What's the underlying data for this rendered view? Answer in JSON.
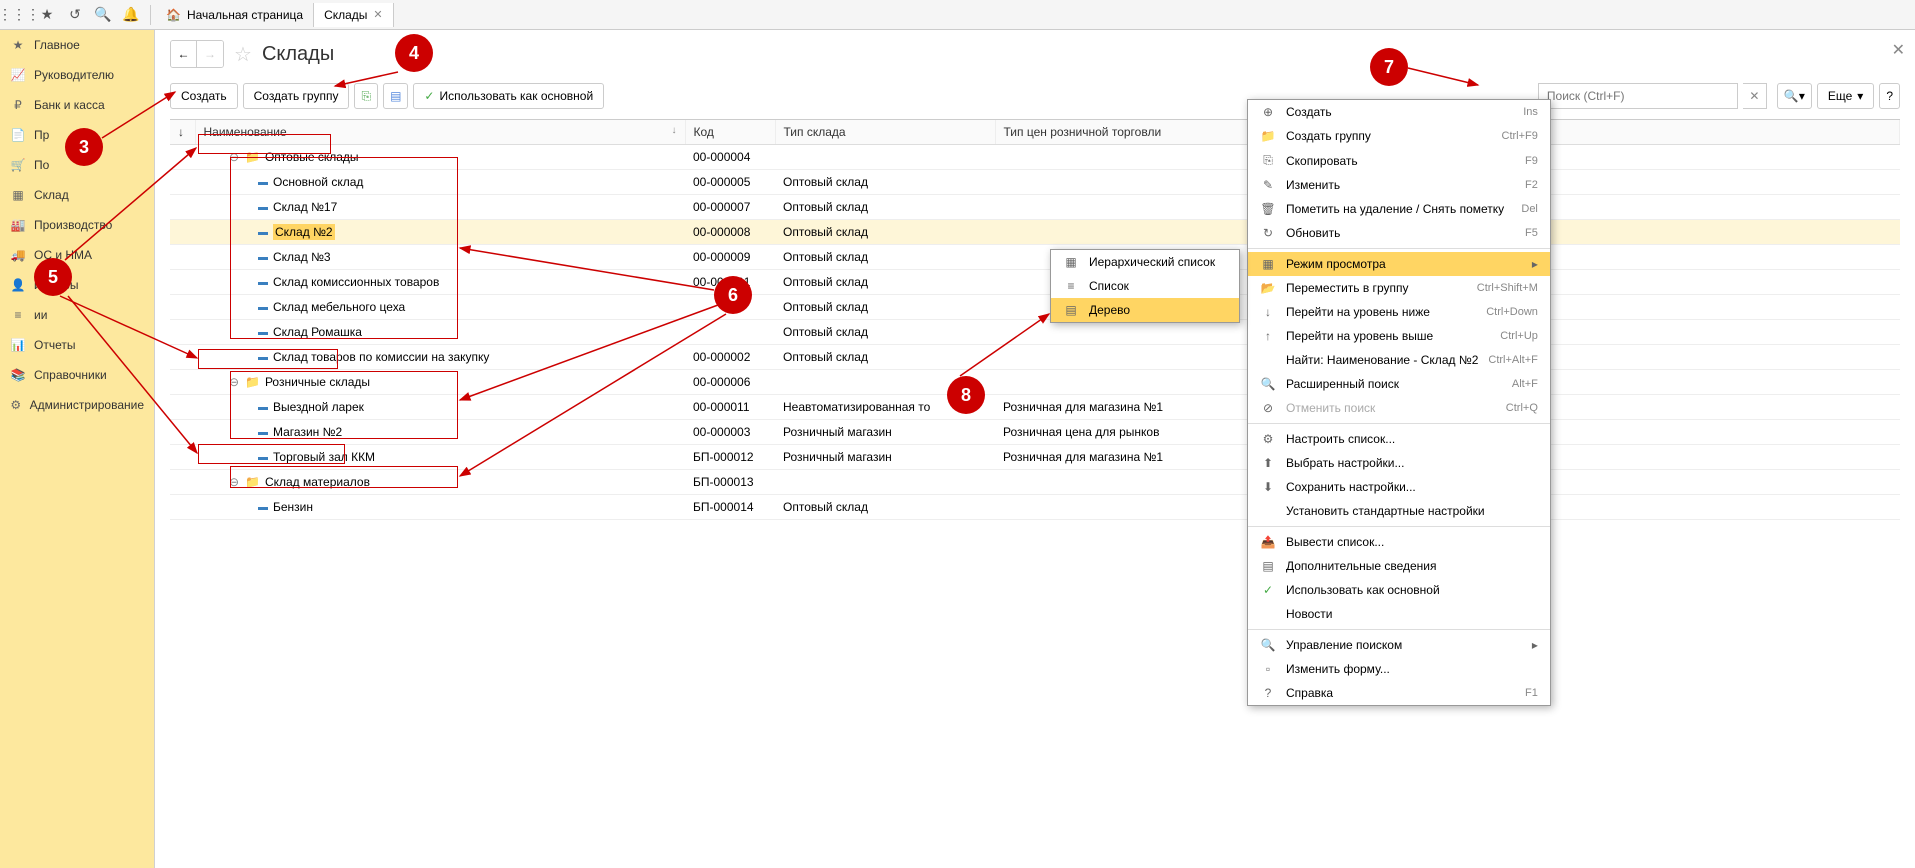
{
  "topbar": {
    "home_tab": "Начальная страница",
    "tab2": "Склады"
  },
  "sidebar": {
    "items": [
      {
        "icon": "★",
        "label": "Главное"
      },
      {
        "icon": "📈",
        "label": "Руководителю"
      },
      {
        "icon": "₽",
        "label": "Банк и касса"
      },
      {
        "icon": "📄",
        "label": "Пр"
      },
      {
        "icon": "🛒",
        "label": "По"
      },
      {
        "icon": "▦",
        "label": "Склад"
      },
      {
        "icon": "🏭",
        "label": "Производство"
      },
      {
        "icon": "🚚",
        "label": "ОС и НМА"
      },
      {
        "icon": "👤",
        "label": "и кадры"
      },
      {
        "icon": "≡",
        "label": "ии"
      },
      {
        "icon": "📊",
        "label": "Отчеты"
      },
      {
        "icon": "📚",
        "label": "Справочники"
      },
      {
        "icon": "⚙",
        "label": "Администрирование"
      }
    ]
  },
  "page": {
    "title": "Склады"
  },
  "toolbar": {
    "create": "Создать",
    "create_group": "Создать группу",
    "use_as_main": "Использовать как основной",
    "search_placeholder": "Поиск (Ctrl+F)",
    "more": "Еще"
  },
  "columns": {
    "name": "Наименование",
    "code": "Код",
    "type": "Тип склада",
    "price_type": "Тип цен розничной торговли"
  },
  "rows": [
    {
      "lvl": 1,
      "folder": true,
      "exp": "⊖",
      "name": "Оптовые склады",
      "code": "00-000004",
      "type": "",
      "price": ""
    },
    {
      "lvl": 2,
      "folder": false,
      "name": "Основной склад",
      "code": "00-000005",
      "type": "Оптовый склад",
      "price": ""
    },
    {
      "lvl": 2,
      "folder": false,
      "name": "Склад №17",
      "code": "00-000007",
      "type": "Оптовый склад",
      "price": ""
    },
    {
      "lvl": 2,
      "folder": false,
      "name": "Склад №2",
      "code": "00-000008",
      "type": "Оптовый склад",
      "price": "",
      "selected": true,
      "hl": true
    },
    {
      "lvl": 2,
      "folder": false,
      "name": "Склад №3",
      "code": "00-000009",
      "type": "Оптовый склад",
      "price": ""
    },
    {
      "lvl": 2,
      "folder": false,
      "name": "Склад комиссионных товаров",
      "code": "00-000001",
      "type": "Оптовый склад",
      "price": ""
    },
    {
      "lvl": 2,
      "folder": false,
      "name": "Склад мебельного цеха",
      "code": "",
      "type": "Оптовый склад",
      "price": ""
    },
    {
      "lvl": 2,
      "folder": false,
      "name": "Склад Ромашка",
      "code": "",
      "type": "Оптовый склад",
      "price": ""
    },
    {
      "lvl": 2,
      "folder": false,
      "name": "Склад товаров по комиссии на закупку",
      "code": "00-000002",
      "type": "Оптовый склад",
      "price": ""
    },
    {
      "lvl": 1,
      "folder": true,
      "exp": "⊖",
      "name": "Розничные склады",
      "code": "00-000006",
      "type": "",
      "price": ""
    },
    {
      "lvl": 2,
      "folder": false,
      "name": "Выездной ларек",
      "code": "00-000011",
      "type": "Неавтоматизированная то",
      "price": "Розничная для магазина №1"
    },
    {
      "lvl": 2,
      "folder": false,
      "name": "Магазин №2",
      "code": "00-000003",
      "type": "Розничный магазин",
      "price": "Розничная цена для рынков"
    },
    {
      "lvl": 2,
      "folder": false,
      "name": "Торговый зал ККМ",
      "code": "БП-000012",
      "type": "Розничный магазин",
      "price": "Розничная для магазина №1"
    },
    {
      "lvl": 1,
      "folder": true,
      "exp": "⊖",
      "name": "Склад материалов",
      "code": "БП-000013",
      "type": "",
      "price": ""
    },
    {
      "lvl": 2,
      "folder": false,
      "name": "Бензин",
      "code": "БП-000014",
      "type": "Оптовый склад",
      "price": ""
    }
  ],
  "submenu": {
    "items": [
      {
        "icon": "▦",
        "label": "Иерархический список"
      },
      {
        "icon": "≡",
        "label": "Список"
      },
      {
        "icon": "▤",
        "label": "Дерево",
        "hl": true
      }
    ]
  },
  "context": {
    "items": [
      {
        "icon": "⊕",
        "label": "Создать",
        "sc": "Ins"
      },
      {
        "icon": "📁",
        "label": "Создать группу",
        "sc": "Ctrl+F9"
      },
      {
        "icon": "⎘",
        "label": "Скопировать",
        "sc": "F9"
      },
      {
        "icon": "✎",
        "label": "Изменить",
        "sc": "F2"
      },
      {
        "icon": "🗑",
        "label": "Пометить на удаление / Снять пометку",
        "sc": "Del"
      },
      {
        "icon": "↻",
        "label": "Обновить",
        "sc": "F5"
      },
      {
        "sep": true
      },
      {
        "icon": "▦",
        "label": "Режим просмотра",
        "arrow": true,
        "hl": true
      },
      {
        "icon": "📂",
        "label": "Переместить в группу",
        "sc": "Ctrl+Shift+M"
      },
      {
        "icon": "↓",
        "label": "Перейти на уровень ниже",
        "sc": "Ctrl+Down"
      },
      {
        "icon": "↑",
        "label": "Перейти на уровень выше",
        "sc": "Ctrl+Up"
      },
      {
        "icon": "",
        "label": "Найти: Наименование - Склад №2",
        "sc": "Ctrl+Alt+F"
      },
      {
        "icon": "🔍",
        "label": "Расширенный поиск",
        "sc": "Alt+F"
      },
      {
        "icon": "⊘",
        "label": "Отменить поиск",
        "sc": "Ctrl+Q",
        "disabled": true
      },
      {
        "sep": true
      },
      {
        "icon": "⚙",
        "label": "Настроить список..."
      },
      {
        "icon": "⬆",
        "label": "Выбрать настройки..."
      },
      {
        "icon": "⬇",
        "label": "Сохранить настройки..."
      },
      {
        "icon": "",
        "label": "Установить стандартные настройки"
      },
      {
        "sep": true
      },
      {
        "icon": "📤",
        "label": "Вывести список..."
      },
      {
        "icon": "▤",
        "label": "Дополнительные сведения"
      },
      {
        "icon": "✓",
        "label": "Использовать как основной",
        "green": true
      },
      {
        "icon": "",
        "label": "Новости"
      },
      {
        "sep": true
      },
      {
        "icon": "🔍",
        "label": "Управление поиском",
        "arrow": true
      },
      {
        "icon": "▫",
        "label": "Изменить форму..."
      },
      {
        "icon": "?",
        "label": "Справка",
        "sc": "F1"
      }
    ]
  },
  "callouts": {
    "3": "3",
    "4": "4",
    "5": "5",
    "6": "6",
    "7": "7",
    "8": "8"
  }
}
